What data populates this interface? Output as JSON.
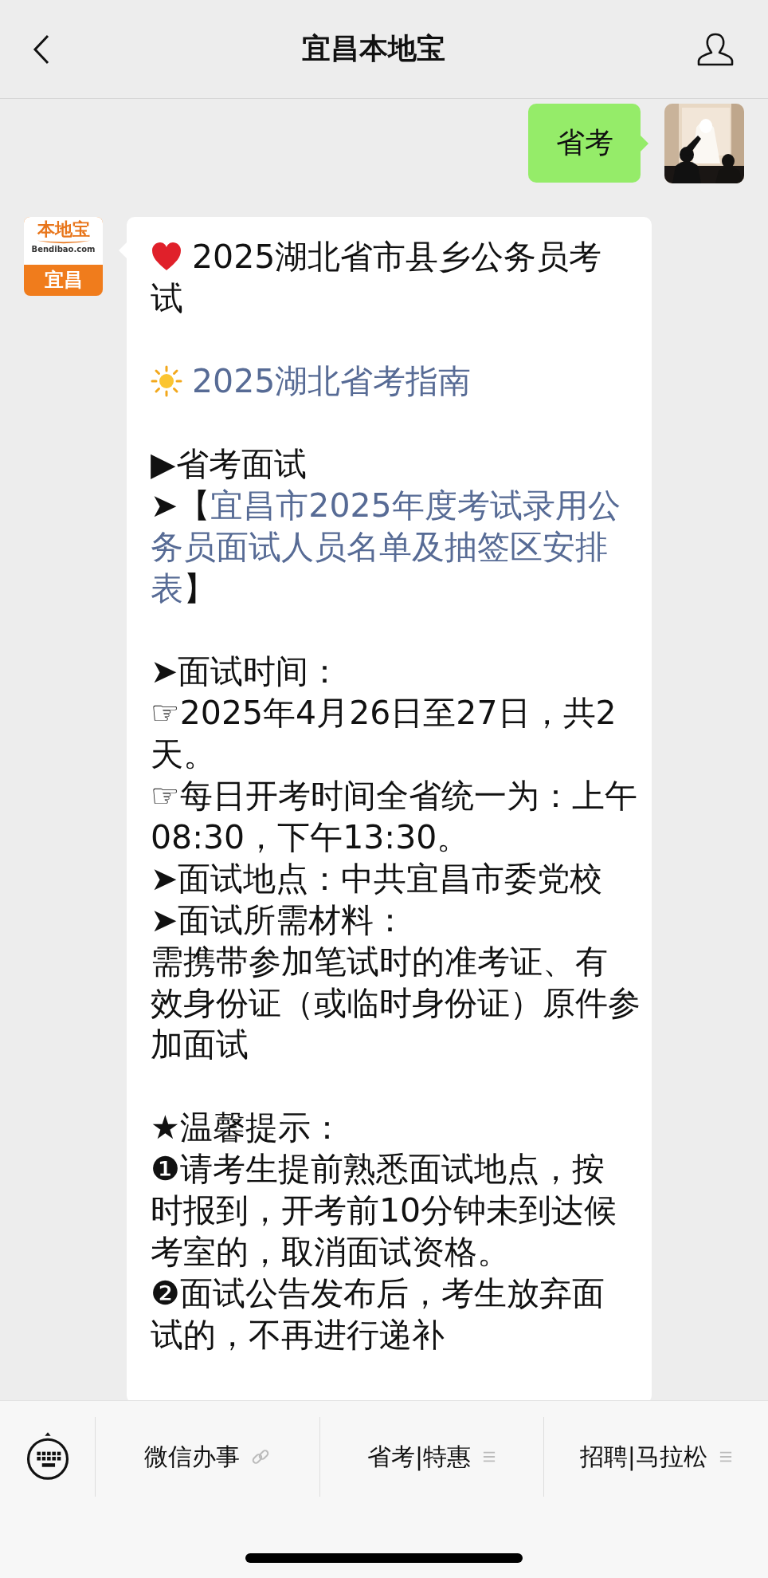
{
  "header": {
    "title": "宜昌本地宝"
  },
  "outgoing": {
    "text": "省考"
  },
  "incoming": {
    "avatar": {
      "brand": "本地宝",
      "domain": "Bendibao.com",
      "city": "宜昌"
    },
    "lines": [
      {
        "kind": "heart",
        "text": "2025湖北省市县乡公务员考"
      },
      {
        "kind": "text",
        "text": "试"
      },
      {
        "kind": "blank"
      },
      {
        "kind": "sun",
        "text": "2025湖北省考指南"
      },
      {
        "kind": "blank"
      },
      {
        "kind": "text",
        "text": "▶省考面试"
      },
      {
        "kind": "link",
        "before": "➤【",
        "link": "宜昌市2025年度考试录用公"
      },
      {
        "kind": "link",
        "link": "务员面试人员名单及抽签区安排"
      },
      {
        "kind": "link",
        "link": "表",
        "after": "】"
      },
      {
        "kind": "blank"
      },
      {
        "kind": "text",
        "text": "➤面试时间："
      },
      {
        "kind": "text",
        "text": "☞2025年4月26日至27日，共2"
      },
      {
        "kind": "text",
        "text": "天。"
      },
      {
        "kind": "text",
        "text": "☞每日开考时间全省统一为：上午"
      },
      {
        "kind": "text",
        "text": "08:30，下午13:30。"
      },
      {
        "kind": "text",
        "text": "➤面试地点：中共宜昌市委党校"
      },
      {
        "kind": "text",
        "text": "➤面试所需材料："
      },
      {
        "kind": "text",
        "text": "需携带参加笔试时的准考证、有"
      },
      {
        "kind": "text",
        "text": "效身份证（或临时身份证）原件参"
      },
      {
        "kind": "text",
        "text": "加面试"
      },
      {
        "kind": "blank"
      },
      {
        "kind": "text",
        "text": "★温馨提示："
      },
      {
        "kind": "text",
        "text": "❶请考生提前熟悉面试地点，按"
      },
      {
        "kind": "text",
        "text": "时报到，开考前10分钟未到达候"
      },
      {
        "kind": "text",
        "text": "考室的，取消面试资格。"
      },
      {
        "kind": "text",
        "text": "❷面试公告发布后，考生放弃面"
      },
      {
        "kind": "text",
        "text": "试的，不再进行递补"
      }
    ]
  },
  "menu": [
    {
      "label": "微信办事",
      "kind": "link"
    },
    {
      "label": "省考|特惠",
      "kind": "submenu"
    },
    {
      "label": "招聘|马拉松",
      "kind": "submenu"
    }
  ]
}
